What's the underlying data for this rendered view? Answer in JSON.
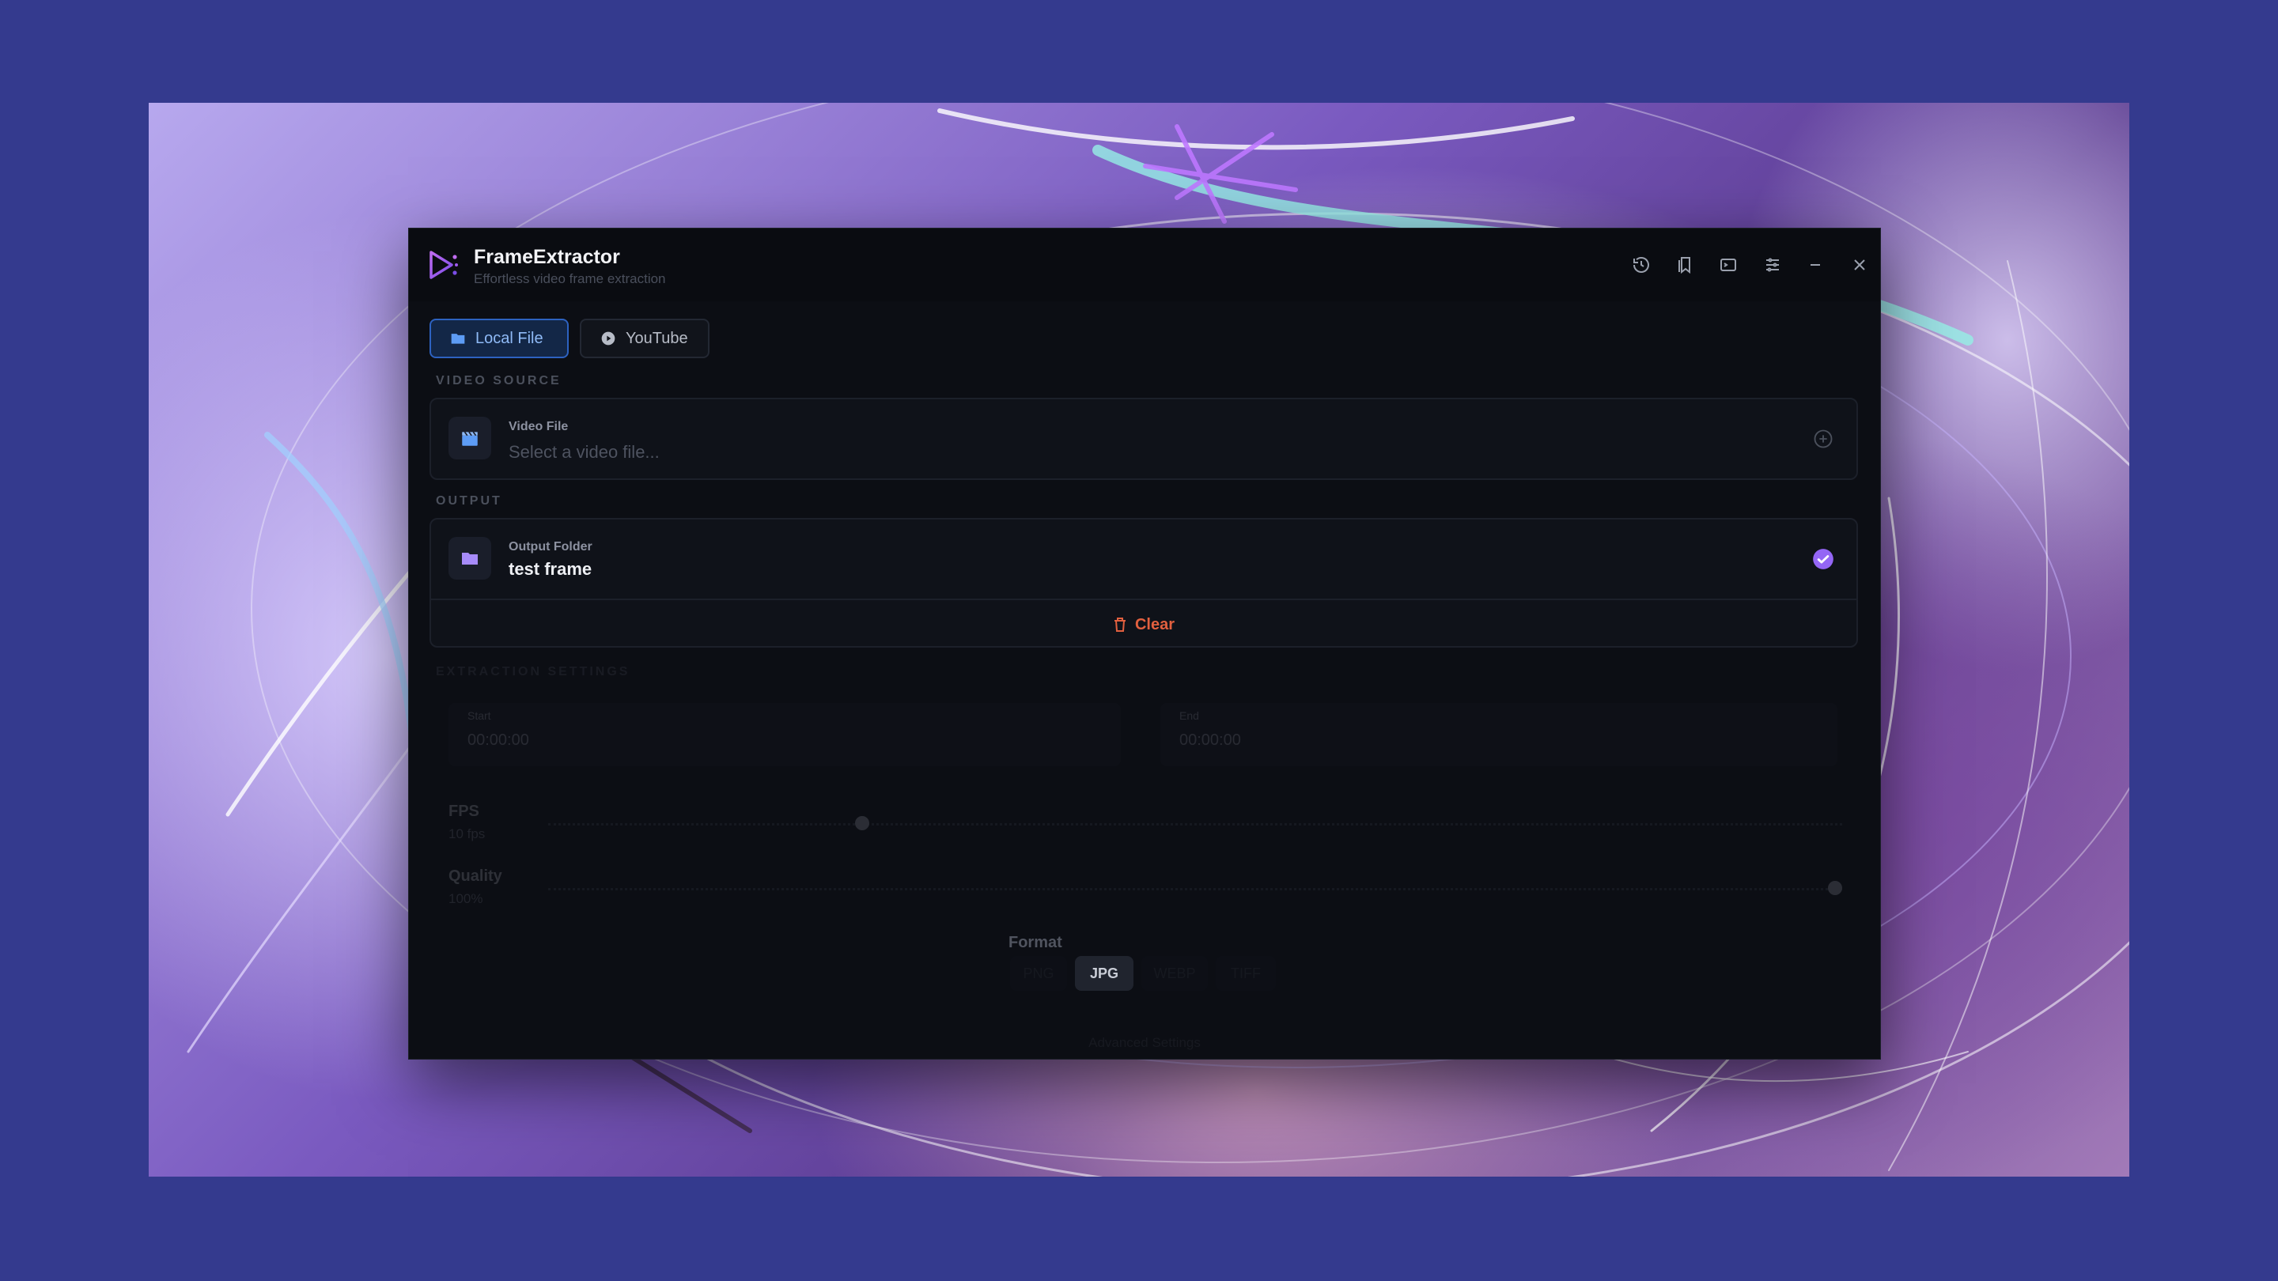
{
  "app": {
    "title": "FrameExtractor",
    "subtitle": "Effortless video frame extraction",
    "accent": "#8b5cf6",
    "titlebar_icons": [
      "history-icon",
      "bookmark-icon",
      "terminal-icon",
      "settings-sliders-icon",
      "minimize-icon",
      "close-icon"
    ]
  },
  "tabs": [
    {
      "label": "Local File",
      "icon": "folder-icon",
      "active": true
    },
    {
      "label": "YouTube",
      "icon": "play-circle-icon",
      "active": false
    }
  ],
  "video_source": {
    "section_label": "VIDEO SOURCE",
    "field_label": "Video File",
    "placeholder": "Select a video file..."
  },
  "output": {
    "section_label": "OUTPUT",
    "field_label": "Output Folder",
    "value": "test frame",
    "clear_label": "Clear"
  },
  "extraction": {
    "section_label": "EXTRACTION SETTINGS",
    "start_label": "Start",
    "start_value": "00:00:00",
    "end_label": "End",
    "end_value": "00:00:00",
    "fps_label": "FPS",
    "fps_value": "10 fps",
    "fps_level": 0.24,
    "quality_label": "Quality",
    "quality_value": "100%",
    "quality_level": 1.0
  },
  "format": {
    "label": "Format",
    "options": [
      "PNG",
      "JPG",
      "WEBP",
      "TIFF"
    ],
    "selected": "JPG"
  },
  "advanced_label": "Advanced Settings"
}
